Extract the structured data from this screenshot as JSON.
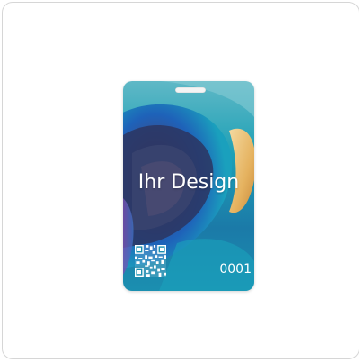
{
  "card": {
    "headline": "Ihr Design",
    "serial": "0001",
    "colors": {
      "teal": "#1fa3b8",
      "deep_blue": "#1f5fb8",
      "purple": "#6f4aa8",
      "gold": "#e7b765",
      "white_text": "#ffffff"
    }
  },
  "icons": {
    "qr": "qr-code-icon",
    "slot": "lanyard-slot"
  }
}
